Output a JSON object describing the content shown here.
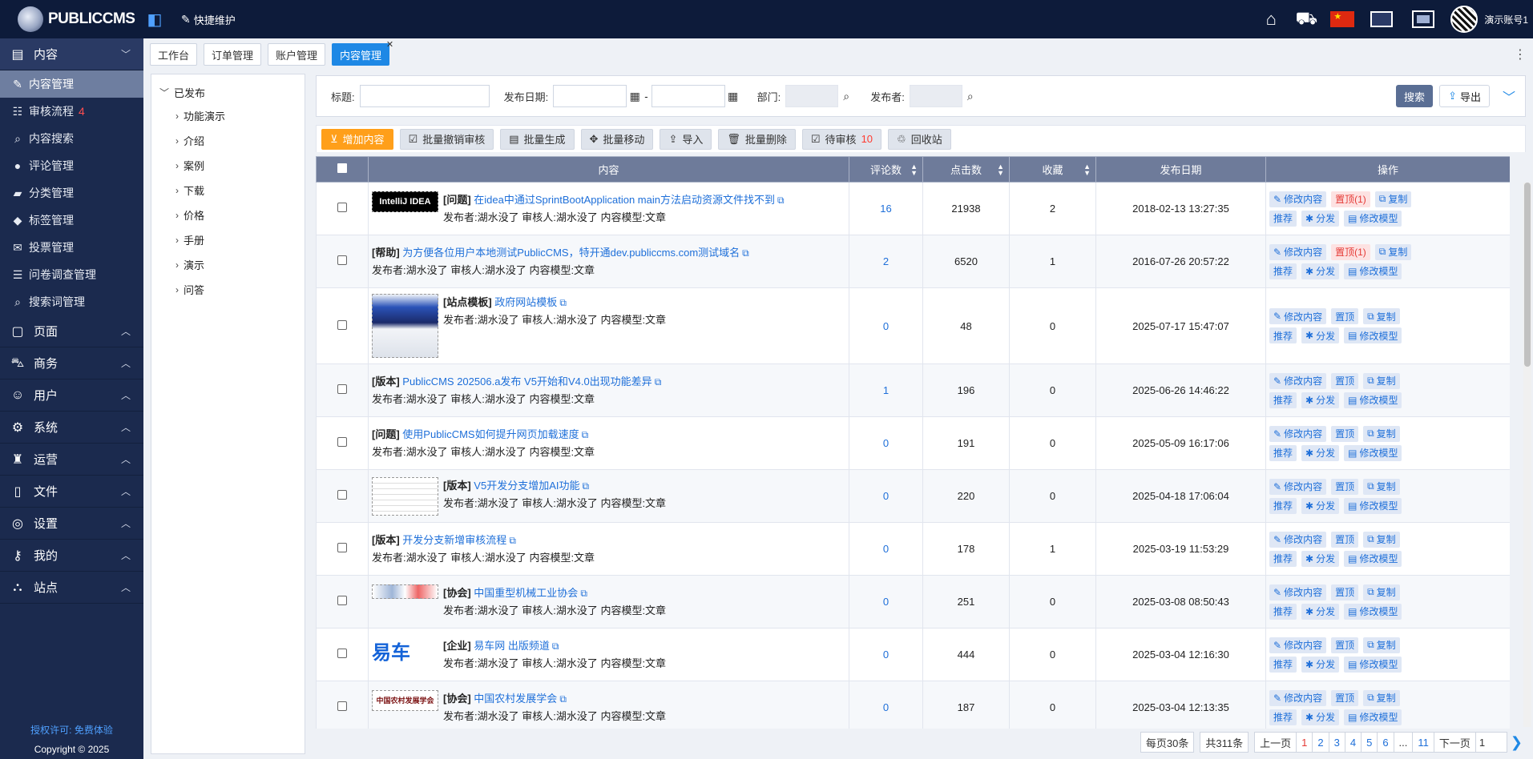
{
  "topbar": {
    "logo_text": "PUBLICCMS",
    "quick_label": "快捷维护",
    "user_name": "演示账号1"
  },
  "sidebar": {
    "groups": [
      {
        "label": "内容",
        "open": true
      },
      {
        "label": "页面"
      },
      {
        "label": "商务"
      },
      {
        "label": "用户"
      },
      {
        "label": "系统"
      },
      {
        "label": "运营"
      },
      {
        "label": "文件"
      },
      {
        "label": "设置"
      },
      {
        "label": "我的"
      },
      {
        "label": "站点"
      }
    ],
    "items": [
      {
        "label": "内容管理",
        "active": true
      },
      {
        "label": "审核流程",
        "count": "4"
      },
      {
        "label": "内容搜索"
      },
      {
        "label": "评论管理"
      },
      {
        "label": "分类管理"
      },
      {
        "label": "标签管理"
      },
      {
        "label": "投票管理"
      },
      {
        "label": "问卷调查管理"
      },
      {
        "label": "搜索词管理"
      }
    ],
    "license": "授权许可: 免费体验",
    "copyright": "Copyright © 2025"
  },
  "tabs": [
    "工作台",
    "订单管理",
    "账户管理",
    "内容管理"
  ],
  "tree": {
    "root": "已发布",
    "nodes": [
      "功能演示",
      "介绍",
      "案例",
      "下载",
      "价格",
      "手册",
      "演示",
      "问答"
    ]
  },
  "search": {
    "title_label": "标题:",
    "date_label": "发布日期:",
    "date_sep": "-",
    "dept_label": "部门:",
    "publisher_label": "发布者:",
    "search_btn": "搜索",
    "export_btn": "导出"
  },
  "toolbar": {
    "add": "增加内容",
    "batch_revoke": "批量撤销审核",
    "batch_gen": "批量生成",
    "batch_move": "批量移动",
    "import": "导入",
    "batch_delete": "批量删除",
    "pending": "待审核",
    "pending_count": "10",
    "recycle": "回收站"
  },
  "table": {
    "headers": [
      "内容",
      "评论数",
      "点击数",
      "收藏",
      "发布日期",
      "操作"
    ],
    "op_labels": {
      "edit": "修改内容",
      "top": "置顶",
      "copy": "复制",
      "recommend": "推荐",
      "distribute": "分发",
      "model": "修改模型"
    },
    "rows": [
      {
        "thumb": "idea",
        "thumb_text": "IntelliJ IDEA",
        "tag": "[问题]",
        "title": "在idea中通过SprintBootApplication main方法启动资源文件找不到",
        "meta": "发布者:湖水没了 审核人:湖水没了 内容模型:文章",
        "comments": "16",
        "clicks": "21938",
        "fav": "2",
        "date": "2018-02-13 13:27:35",
        "top": "置顶(1)"
      },
      {
        "thumb": "",
        "thumb_text": "",
        "tag": "[帮助]",
        "title": "为方便各位用户本地测试PublicCMS，特开通dev.publiccms.com测试域名",
        "meta": "发布者:湖水没了 审核人:湖水没了 内容模型:文章",
        "comments": "2",
        "clicks": "6520",
        "fav": "1",
        "date": "2016-07-26 20:57:22",
        "top": "置顶(1)"
      },
      {
        "thumb": "tall",
        "thumb_text": "",
        "tag": "[站点模板]",
        "title": "政府网站模板",
        "meta": "发布者:湖水没了 审核人:湖水没了 内容模型:文章",
        "comments": "0",
        "clicks": "48",
        "fav": "0",
        "date": "2025-07-17 15:47:07",
        "top": "置顶"
      },
      {
        "thumb": "",
        "thumb_text": "",
        "tag": "[版本]",
        "title": "PublicCMS 202506.a发布 V5开始和V4.0出现功能差异",
        "meta": "发布者:湖水没了 审核人:湖水没了 内容模型:文章",
        "comments": "1",
        "clicks": "196",
        "fav": "0",
        "date": "2025-06-26 14:46:22",
        "top": "置顶"
      },
      {
        "thumb": "",
        "thumb_text": "",
        "tag": "[问题]",
        "title": "使用PublicCMS如何提升网页加载速度",
        "meta": "发布者:湖水没了 审核人:湖水没了 内容模型:文章",
        "comments": "0",
        "clicks": "191",
        "fav": "0",
        "date": "2025-05-09 16:17:06",
        "top": "置顶"
      },
      {
        "thumb": "doc",
        "thumb_text": "",
        "tag": "[版本]",
        "title": "V5开发分支增加AI功能",
        "meta": "发布者:湖水没了 审核人:湖水没了 内容模型:文章",
        "comments": "0",
        "clicks": "220",
        "fav": "0",
        "date": "2025-04-18 17:06:04",
        "top": "置顶"
      },
      {
        "thumb": "",
        "thumb_text": "",
        "tag": "[版本]",
        "title": "开发分支新增审核流程",
        "meta": "发布者:湖水没了 审核人:湖水没了 内容模型:文章",
        "comments": "0",
        "clicks": "178",
        "fav": "1",
        "date": "2025-03-19 11:53:29",
        "top": "置顶"
      },
      {
        "thumb": "assoc",
        "thumb_text": "",
        "tag": "[协会]",
        "title": "中国重型机械工业协会",
        "meta": "发布者:湖水没了 审核人:湖水没了 内容模型:文章",
        "comments": "0",
        "clicks": "251",
        "fav": "0",
        "date": "2025-03-08 08:50:43",
        "top": "置顶"
      },
      {
        "thumb": "yiche",
        "thumb_text": "易车",
        "tag": "[企业]",
        "title": "易车网 出版频道",
        "meta": "发布者:湖水没了 审核人:湖水没了 内容模型:文章",
        "comments": "0",
        "clicks": "444",
        "fav": "0",
        "date": "2025-03-04 12:16:30",
        "top": "置顶"
      },
      {
        "thumb": "nongcun",
        "thumb_text": "中国农村发展学会",
        "tag": "[协会]",
        "title": "中国农村发展学会",
        "meta": "发布者:湖水没了 审核人:湖水没了 内容模型:文章",
        "comments": "0",
        "clicks": "187",
        "fav": "0",
        "date": "2025-03-04 12:13:35",
        "top": "置顶"
      }
    ]
  },
  "pager": {
    "per_page": "每页30条",
    "total": "共311条",
    "prev": "上一页",
    "pages": [
      "1",
      "2",
      "3",
      "4",
      "5",
      "6",
      "...",
      "11"
    ],
    "next": "下一页",
    "current_input": "1"
  }
}
